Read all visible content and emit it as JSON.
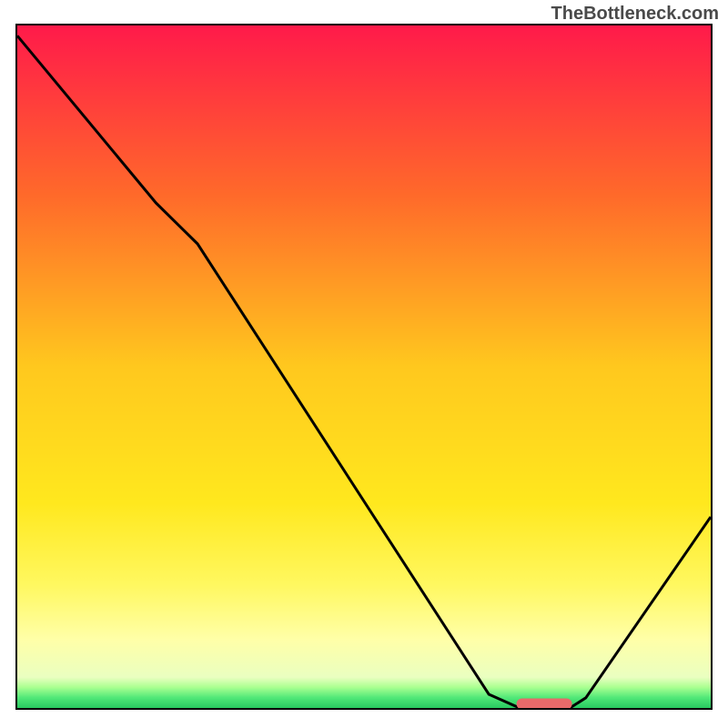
{
  "watermark": "TheBottleneck.com",
  "chart_data": {
    "type": "line",
    "title": "",
    "xlabel": "",
    "ylabel": "",
    "xlim": [
      0,
      100
    ],
    "ylim": [
      0,
      100
    ],
    "gradient_stops": [
      {
        "offset": 0,
        "color": "#ff1a4a"
      },
      {
        "offset": 0.25,
        "color": "#ff6a2a"
      },
      {
        "offset": 0.5,
        "color": "#ffc81e"
      },
      {
        "offset": 0.7,
        "color": "#ffe81e"
      },
      {
        "offset": 0.82,
        "color": "#fff860"
      },
      {
        "offset": 0.9,
        "color": "#ffffa8"
      },
      {
        "offset": 0.955,
        "color": "#eaffc0"
      },
      {
        "offset": 0.97,
        "color": "#a8ff90"
      },
      {
        "offset": 0.985,
        "color": "#50e878"
      },
      {
        "offset": 1.0,
        "color": "#28c860"
      }
    ],
    "curve": [
      {
        "x": 0,
        "y": 98.5
      },
      {
        "x": 20,
        "y": 74
      },
      {
        "x": 26,
        "y": 68
      },
      {
        "x": 68,
        "y": 2
      },
      {
        "x": 72,
        "y": 0.2
      },
      {
        "x": 80,
        "y": 0.2
      },
      {
        "x": 82,
        "y": 1.5
      },
      {
        "x": 100,
        "y": 28
      }
    ],
    "marker": {
      "x_start": 72,
      "x_end": 80,
      "y": 0.6,
      "color": "#e86a6a"
    }
  }
}
